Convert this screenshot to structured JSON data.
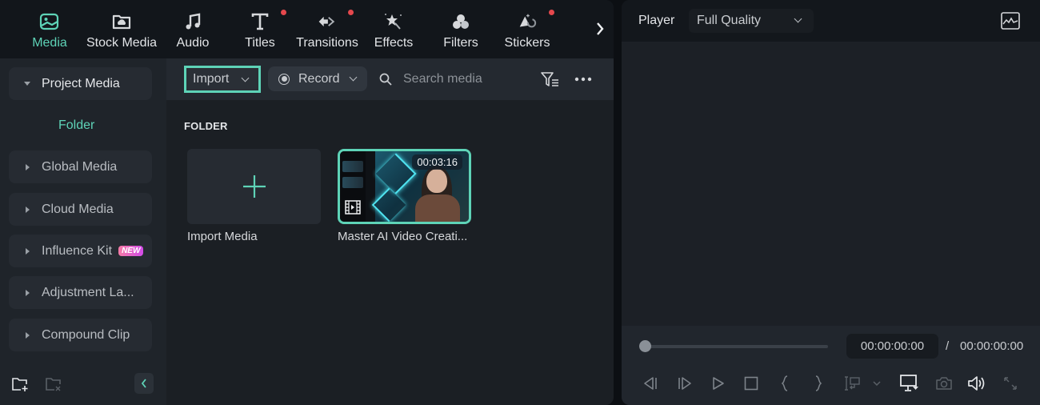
{
  "topnav": {
    "items": [
      {
        "label": "Media",
        "icon": "media-icon",
        "active": true,
        "dot": false
      },
      {
        "label": "Stock Media",
        "icon": "stock-media-icon",
        "active": false,
        "dot": false
      },
      {
        "label": "Audio",
        "icon": "music-note-icon",
        "active": false,
        "dot": false
      },
      {
        "label": "Titles",
        "icon": "titles-icon",
        "active": false,
        "dot": true
      },
      {
        "label": "Transitions",
        "icon": "transitions-icon",
        "active": false,
        "dot": true
      },
      {
        "label": "Effects",
        "icon": "effects-icon",
        "active": false,
        "dot": false
      },
      {
        "label": "Filters",
        "icon": "filters-icon",
        "active": false,
        "dot": false
      },
      {
        "label": "Stickers",
        "icon": "stickers-icon",
        "active": false,
        "dot": true
      }
    ],
    "more_icon": "chevron-right-icon"
  },
  "sidebar": {
    "items": [
      {
        "label": "Project Media",
        "expanded": true
      },
      {
        "label": "Global Media",
        "expanded": false
      },
      {
        "label": "Cloud Media",
        "expanded": false
      },
      {
        "label": "Influence Kit",
        "expanded": false,
        "badge": "NEW"
      },
      {
        "label": "Adjustment La...",
        "expanded": false
      },
      {
        "label": "Compound Clip",
        "expanded": false
      }
    ],
    "subitem": "Folder",
    "bottom": {
      "new_folder_icon": "new-folder-icon",
      "delete_folder_icon": "delete-folder-icon",
      "collapse_icon": "chevron-left-icon"
    }
  },
  "toolbar": {
    "import_label": "Import",
    "record_label": "Record",
    "search_placeholder": "Search media",
    "filter_icon": "filter-icon",
    "more_icon": "more-horizontal-icon"
  },
  "content": {
    "section_label": "FOLDER",
    "import_tile_label": "Import Media",
    "media": [
      {
        "name": "Master AI Video Creati...",
        "duration": "00:03:16",
        "selected": true
      }
    ]
  },
  "player": {
    "title": "Player",
    "quality": "Full Quality",
    "scope_icon": "waveform-monitor-icon",
    "progress": 0,
    "current_time": "00:00:00:00",
    "separator": "/",
    "total_time": "00:00:00:00",
    "controls": [
      "previous-frame-icon",
      "next-frame-icon",
      "play-icon",
      "stop-icon",
      "mark-in-icon",
      "mark-out-icon",
      "insert-icon",
      "chevron-down-icon",
      "display-settings-icon",
      "snapshot-icon",
      "volume-icon",
      "fullscreen-icon"
    ]
  },
  "colors": {
    "accent": "#5ed3b7",
    "notification_dot": "#e5484d",
    "panel_bg": "#1b1f24",
    "nav_bg": "#12161b"
  }
}
